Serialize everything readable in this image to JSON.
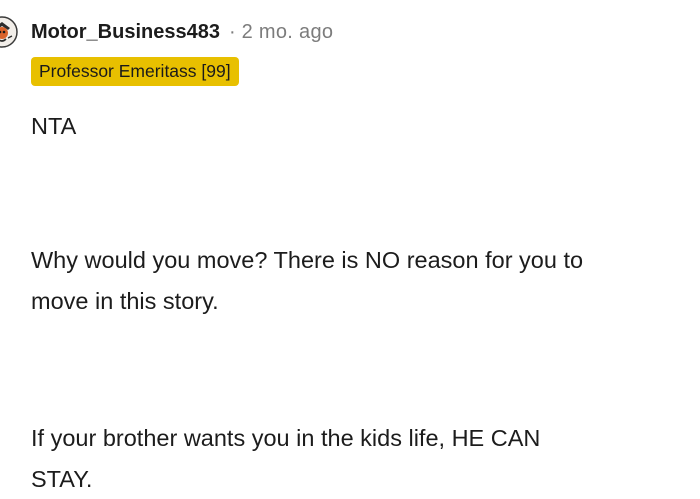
{
  "comment": {
    "author": "Motor_Business483",
    "separator": "·",
    "timestamp": "2 mo. ago",
    "flair": "Professor Emeritass [99]",
    "avatar_icon": "user-avatar-icon",
    "paragraphs": [
      [
        "NTA"
      ],
      [
        "Why would you move? There is NO reason for you to",
        "move in this story."
      ],
      [
        "If your brother wants you in the kids life, HE CAN",
        "STAY."
      ]
    ]
  },
  "colors": {
    "flair_background": "#e8c000",
    "muted_text": "#7c7c7c",
    "body_text": "#1c1c1c"
  }
}
